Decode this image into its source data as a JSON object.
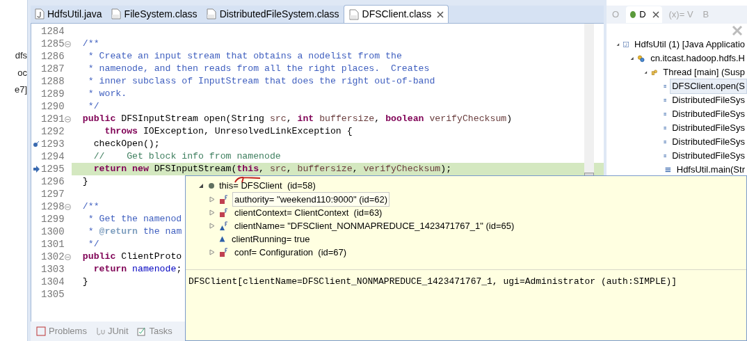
{
  "left_panel": {
    "items": [
      "dfs",
      "oc",
      "e7]"
    ]
  },
  "editor": {
    "tabs": [
      {
        "label": "HdfsUtil.java",
        "kind": "java",
        "selected": false
      },
      {
        "label": "FileSystem.class",
        "kind": "class",
        "selected": false
      },
      {
        "label": "DistributedFileSystem.class",
        "kind": "class",
        "selected": false
      },
      {
        "label": "DFSClient.class",
        "kind": "class",
        "selected": true
      }
    ],
    "lines": [
      {
        "number": "1284",
        "fold": false,
        "breakpoint": false,
        "instruction_pointer": false,
        "current": false
      },
      {
        "number": "1285",
        "fold": true,
        "breakpoint": false,
        "instruction_pointer": false,
        "current": false,
        "tokens": [
          {
            "kind": "comment",
            "text": "  /**"
          }
        ]
      },
      {
        "number": "1286",
        "fold": false,
        "breakpoint": false,
        "instruction_pointer": false,
        "current": false,
        "tokens": [
          {
            "kind": "comment",
            "text": "   * Create an input stream that obtains a nodelist from the"
          }
        ]
      },
      {
        "number": "1287",
        "fold": false,
        "breakpoint": false,
        "instruction_pointer": false,
        "current": false,
        "tokens": [
          {
            "kind": "comment",
            "text": "   * namenode, and then reads from all the right places.  Creates"
          }
        ]
      },
      {
        "number": "1288",
        "fold": false,
        "breakpoint": false,
        "instruction_pointer": false,
        "current": false,
        "tokens": [
          {
            "kind": "comment",
            "text": "   * inner subclass of InputStream that does the right out-of-band"
          }
        ]
      },
      {
        "number": "1289",
        "fold": false,
        "breakpoint": false,
        "instruction_pointer": false,
        "current": false,
        "tokens": [
          {
            "kind": "comment",
            "text": "   * work."
          }
        ]
      },
      {
        "number": "1290",
        "fold": false,
        "breakpoint": false,
        "instruction_pointer": false,
        "current": false,
        "tokens": [
          {
            "kind": "comment",
            "text": "   */"
          }
        ]
      },
      {
        "number": "1291",
        "fold": true,
        "breakpoint": false,
        "instruction_pointer": false,
        "current": false,
        "tokens": [
          {
            "kind": "keyword",
            "text": "  public"
          },
          {
            "kind": "plain",
            "text": " DFSInputStream open(String "
          },
          {
            "kind": "param",
            "text": "src"
          },
          {
            "kind": "plain",
            "text": ", "
          },
          {
            "kind": "keyword",
            "text": "int"
          },
          {
            "kind": "param",
            "text": " buffersize"
          },
          {
            "kind": "plain",
            "text": ", "
          },
          {
            "kind": "keyword",
            "text": "boolean"
          },
          {
            "kind": "param",
            "text": " verifyChecksum"
          },
          {
            "kind": "plain",
            "text": ")"
          }
        ]
      },
      {
        "number": "1292",
        "fold": false,
        "breakpoint": false,
        "instruction_pointer": false,
        "current": false,
        "tokens": [
          {
            "kind": "keyword",
            "text": "      throws"
          },
          {
            "kind": "plain",
            "text": " IOException, UnresolvedLinkException {"
          }
        ]
      },
      {
        "number": "1293",
        "fold": false,
        "breakpoint": true,
        "instruction_pointer": false,
        "current": false,
        "tokens": [
          {
            "kind": "plain",
            "text": "    checkOpen();"
          }
        ]
      },
      {
        "number": "1294",
        "fold": false,
        "breakpoint": false,
        "instruction_pointer": false,
        "current": false,
        "tokens": [
          {
            "kind": "linecomment",
            "text": "    //    Get block info from namenode"
          }
        ]
      },
      {
        "number": "1295",
        "fold": false,
        "breakpoint": false,
        "instruction_pointer": true,
        "current": true,
        "tokens": [
          {
            "kind": "keyword",
            "text": "    return new"
          },
          {
            "kind": "plain",
            "text": " DFSInputStream("
          },
          {
            "kind": "keyword",
            "text": "this"
          },
          {
            "kind": "plain",
            "text": ", "
          },
          {
            "kind": "param",
            "text": "src"
          },
          {
            "kind": "plain",
            "text": ", "
          },
          {
            "kind": "param",
            "text": "buffersize"
          },
          {
            "kind": "plain",
            "text": ", "
          },
          {
            "kind": "param",
            "text": "verifyChecksum"
          },
          {
            "kind": "plain",
            "text": ");"
          }
        ]
      },
      {
        "number": "1296",
        "fold": false,
        "breakpoint": false,
        "instruction_pointer": false,
        "current": false,
        "tokens": [
          {
            "kind": "plain",
            "text": "  }"
          }
        ]
      },
      {
        "number": "1297",
        "fold": false,
        "breakpoint": false,
        "instruction_pointer": false,
        "current": false
      },
      {
        "number": "1298",
        "fold": true,
        "breakpoint": false,
        "instruction_pointer": false,
        "current": false,
        "tokens": [
          {
            "kind": "comment",
            "text": "  /**"
          }
        ]
      },
      {
        "number": "1299",
        "fold": false,
        "breakpoint": false,
        "instruction_pointer": false,
        "current": false,
        "tokens": [
          {
            "kind": "comment",
            "text": "   * Get the namenod"
          }
        ]
      },
      {
        "number": "1300",
        "fold": false,
        "breakpoint": false,
        "instruction_pointer": false,
        "current": false,
        "tokens": [
          {
            "kind": "comment",
            "text": "   * "
          },
          {
            "kind": "tag",
            "text": "@return"
          },
          {
            "kind": "comment",
            "text": " the nam"
          }
        ]
      },
      {
        "number": "1301",
        "fold": false,
        "breakpoint": false,
        "instruction_pointer": false,
        "current": false,
        "tokens": [
          {
            "kind": "comment",
            "text": "   */"
          }
        ]
      },
      {
        "number": "1302",
        "fold": true,
        "breakpoint": false,
        "instruction_pointer": false,
        "current": false,
        "tokens": [
          {
            "kind": "keyword",
            "text": "  public"
          },
          {
            "kind": "plain",
            "text": " ClientProto"
          }
        ]
      },
      {
        "number": "1303",
        "fold": false,
        "breakpoint": false,
        "instruction_pointer": false,
        "current": false,
        "tokens": [
          {
            "kind": "keyword",
            "text": "    return"
          },
          {
            "kind": "field",
            "text": " namenode"
          },
          {
            "kind": "plain",
            "text": ";"
          }
        ]
      },
      {
        "number": "1304",
        "fold": false,
        "breakpoint": false,
        "instruction_pointer": false,
        "current": false,
        "tokens": [
          {
            "kind": "plain",
            "text": "  }"
          }
        ]
      },
      {
        "number": "1305",
        "fold": false,
        "breakpoint": false,
        "instruction_pointer": false,
        "current": false
      }
    ]
  },
  "bottom_tabs": [
    {
      "label": "Problems",
      "kind": "problems"
    },
    {
      "label": "JUnit",
      "kind": "junit"
    },
    {
      "label": "Tasks",
      "kind": "tasks"
    }
  ],
  "debug_panel": {
    "tabs": [
      {
        "label": "O",
        "kind": "outline",
        "selected": false
      },
      {
        "label": "D",
        "kind": "debug",
        "selected": true
      },
      {
        "label": "(x)= V",
        "kind": "variables",
        "selected": false
      },
      {
        "label": "B",
        "kind": "breakpoints",
        "selected": false
      }
    ],
    "tree": [
      {
        "label": "HdfsUtil (1) [Java Applicatio",
        "kind": "app",
        "expanded": true,
        "selected": false,
        "children": [
          {
            "label": "cn.itcast.hadoop.hdfs.H",
            "kind": "process",
            "expanded": true,
            "selected": false,
            "children": [
              {
                "label": "Thread [main] (Susp",
                "kind": "thread",
                "expanded": true,
                "selected": false,
                "children": [
                  {
                    "label": "DFSClient.open(S",
                    "kind": "frame",
                    "selected": true
                  },
                  {
                    "label": "DistributedFileSys",
                    "kind": "frame",
                    "selected": false
                  },
                  {
                    "label": "DistributedFileSys",
                    "kind": "frame",
                    "selected": false
                  },
                  {
                    "label": "DistributedFileSys",
                    "kind": "frame",
                    "selected": false
                  },
                  {
                    "label": "DistributedFileSys",
                    "kind": "frame",
                    "selected": false
                  },
                  {
                    "label": "DistributedFileSys",
                    "kind": "frame",
                    "selected": false
                  },
                  {
                    "label": "HdfsUtil.main(Str",
                    "kind": "frame",
                    "selected": false
                  }
                ]
              }
            ]
          }
        ]
      }
    ]
  },
  "hover": {
    "root": {
      "label": "this= DFSClient  (id=58)",
      "expanded": true
    },
    "fields": [
      {
        "label": "authority= \"weekend110:9000\" (id=62)",
        "kind": "private_final",
        "expandable": true,
        "selected": true
      },
      {
        "label": "clientContext= ClientContext  (id=63)",
        "kind": "private_final",
        "expandable": true,
        "selected": false
      },
      {
        "label": "clientName= \"DFSClient_NONMAPREDUCE_1423471767_1\" (id=65)",
        "kind": "package_final",
        "expandable": true,
        "selected": false
      },
      {
        "label": "clientRunning= true",
        "kind": "package",
        "expandable": false,
        "selected": false
      },
      {
        "label": "conf= Configuration  (id=67)",
        "kind": "private_final",
        "expandable": true,
        "selected": false
      }
    ],
    "detail": "DFSClient[clientName=DFSClient_NONMAPREDUCE_1423471767_1, ugi=Administrator (auth:SIMPLE)]"
  }
}
